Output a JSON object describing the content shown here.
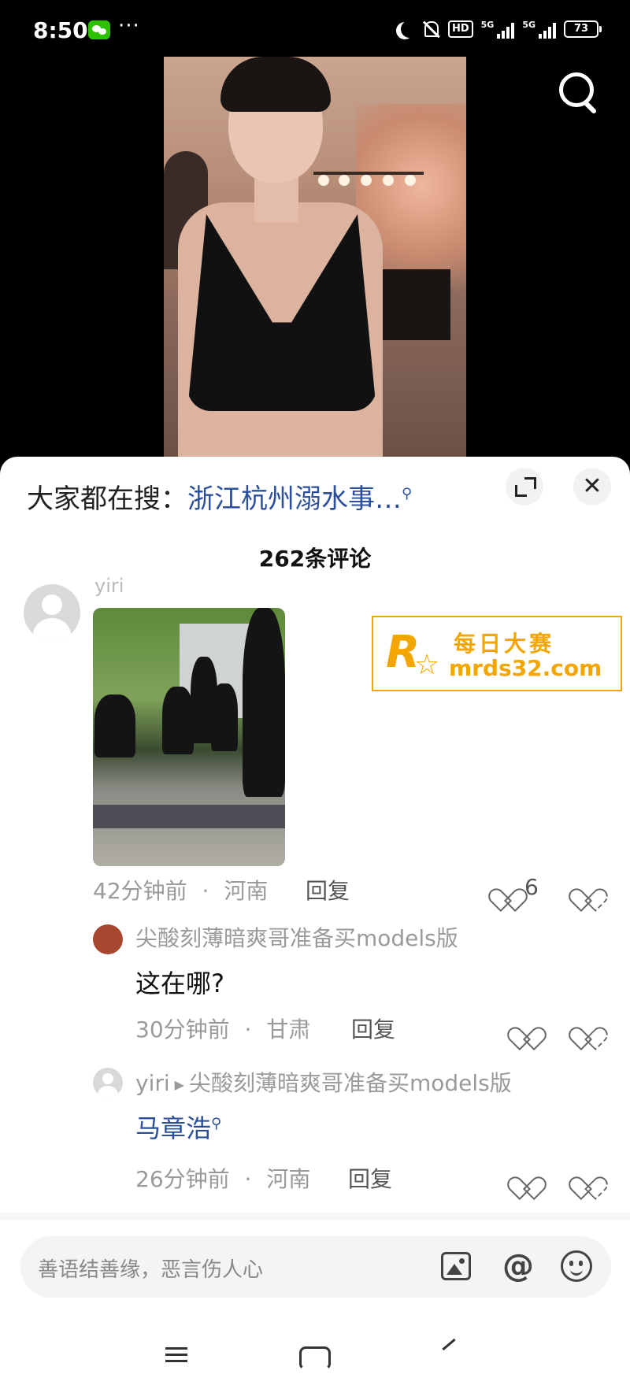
{
  "status_bar": {
    "time": "8:50",
    "dots": "···",
    "hd_label": "HD",
    "signal1_label": "5G",
    "signal2_label": "5G",
    "battery": "73"
  },
  "sheet": {
    "hot_search_prefix": "大家都在搜：",
    "hot_search_link": "浙江杭州溺水事…",
    "close_glyph": "✕",
    "comment_count": "262条评论"
  },
  "comments": [
    {
      "username": "yiri",
      "time": "42分钟前",
      "region": "河南",
      "separator": "·",
      "reply_label": "回复",
      "likes": "6"
    },
    {
      "username": "尖酸刻薄暗爽哥准备买models版",
      "text": "这在哪?",
      "time": "30分钟前",
      "region": "甘肃",
      "separator": "·",
      "reply_label": "回复"
    },
    {
      "username": "yiri",
      "reply_to": "尖酸刻薄暗爽哥准备买models版",
      "arrow": "▶",
      "text": "马章浩",
      "time": "26分钟前",
      "region": "河南",
      "separator": "·",
      "reply_label": "回复"
    }
  ],
  "watermark": {
    "logo_letter": "R",
    "name": "每日大赛",
    "url": "mrds32.com"
  },
  "input": {
    "placeholder": "善语结善缘，恶言伤人心",
    "at_glyph": "@"
  },
  "colors": {
    "accent_link": "#2b4f9b",
    "watermark": "#f3a500"
  }
}
